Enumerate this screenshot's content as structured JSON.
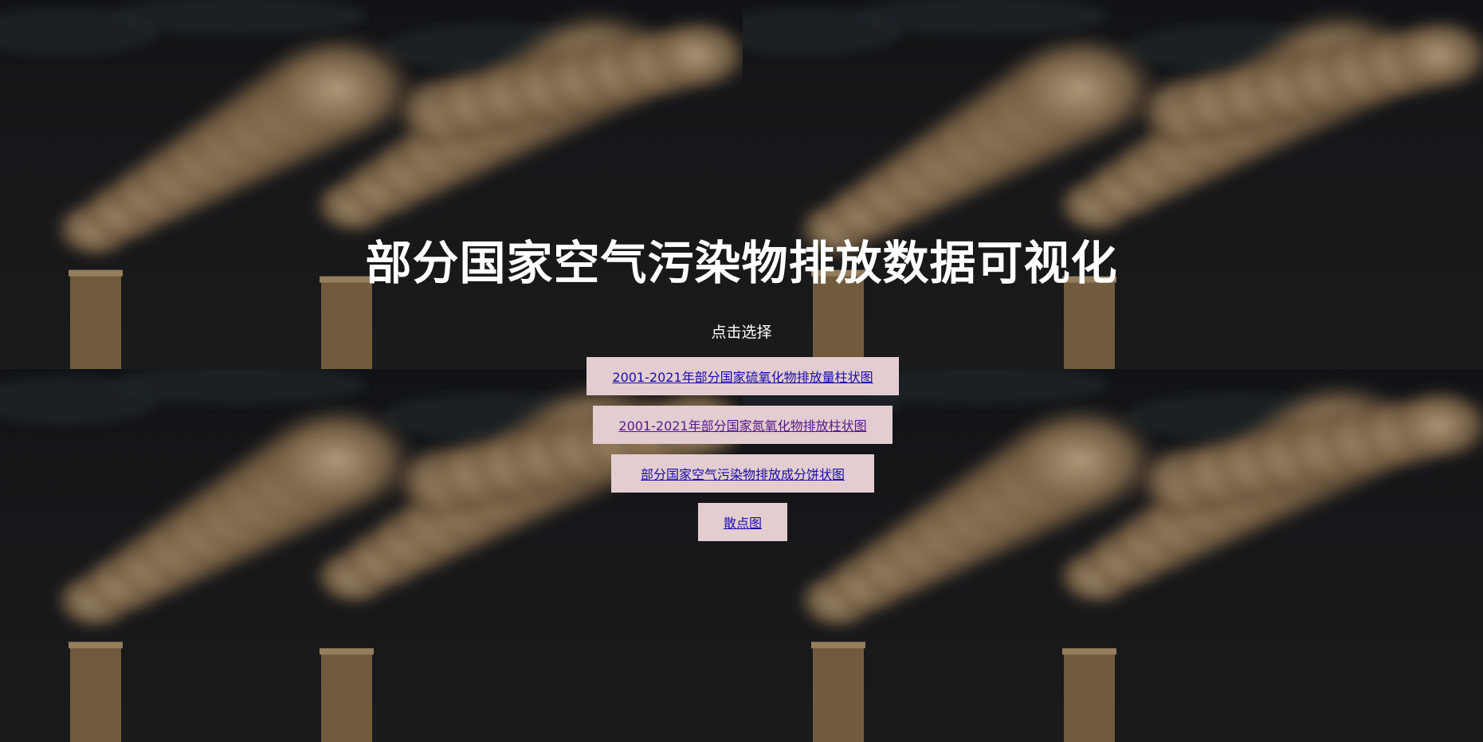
{
  "page": {
    "title": "部分国家空气污染物排放数据可视化",
    "prompt": "点击选择"
  },
  "links": [
    {
      "label": "2001-2021年部分国家硫氧化物排放量柱状图",
      "visited": false
    },
    {
      "label": "2001-2021年部分国家氮氧化物排放柱状图",
      "visited": true
    },
    {
      "label": "部分国家空气污染物排放成分饼状图",
      "visited": false
    },
    {
      "label": "散点图",
      "visited": false
    }
  ],
  "colors": {
    "link": "#1a0dab",
    "link_visited": "#551a8b",
    "button_bg": "#e3cdd0",
    "title": "#ffffff"
  },
  "background": {
    "image": "smoke-stacks-photo",
    "tiles": 4
  }
}
